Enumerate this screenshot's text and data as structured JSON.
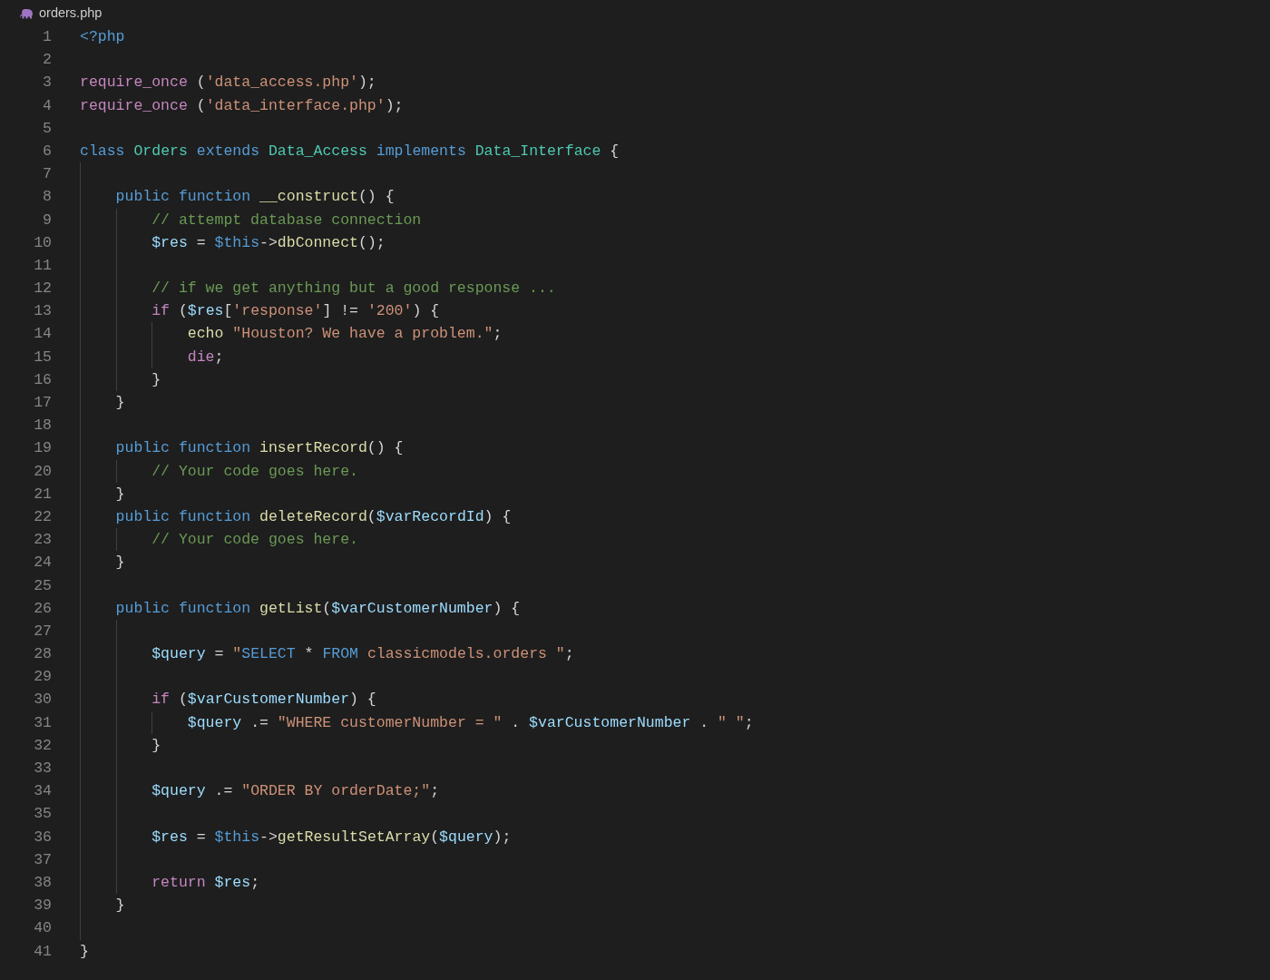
{
  "tab": {
    "label": "orders.php"
  },
  "lines": [
    {
      "number": "1",
      "tokens": [
        {
          "kind": "keyword",
          "text": "<?php"
        }
      ]
    },
    {
      "number": "2"
    },
    {
      "number": "3",
      "tokens": [
        {
          "kind": "control",
          "text": "require_once"
        },
        {
          "kind": "plain",
          "text": " ("
        },
        {
          "kind": "string",
          "text": "'data_access.php'"
        },
        {
          "kind": "plain",
          "text": ");"
        }
      ]
    },
    {
      "number": "4",
      "tokens": [
        {
          "kind": "control",
          "text": "require_once"
        },
        {
          "kind": "plain",
          "text": " ("
        },
        {
          "kind": "string",
          "text": "'data_interface.php'"
        },
        {
          "kind": "plain",
          "text": ");"
        }
      ]
    },
    {
      "number": "5"
    },
    {
      "number": "6",
      "tokens": [
        {
          "kind": "keyword",
          "text": "class "
        },
        {
          "kind": "type",
          "text": "Orders"
        },
        {
          "kind": "keyword",
          "text": " extends "
        },
        {
          "kind": "type",
          "text": "Data_Access"
        },
        {
          "kind": "keyword",
          "text": " implements "
        },
        {
          "kind": "type",
          "text": "Data_Interface"
        },
        {
          "kind": "plain",
          "text": " {"
        }
      ],
      "children": [
        {
          "number": "7"
        },
        {
          "number": "8",
          "tokens": [
            {
              "kind": "keyword",
              "text": "public function "
            },
            {
              "kind": "function",
              "text": "__construct"
            },
            {
              "kind": "plain",
              "text": "() {"
            }
          ],
          "children": [
            {
              "number": "9",
              "tokens": [
                {
                  "kind": "comment",
                  "text": "// attempt database connection"
                }
              ]
            },
            {
              "number": "10",
              "tokens": [
                {
                  "kind": "variable",
                  "text": "$res"
                },
                {
                  "kind": "plain",
                  "text": " = "
                },
                {
                  "kind": "keyword",
                  "text": "$this"
                },
                {
                  "kind": "plain",
                  "text": "->"
                },
                {
                  "kind": "function",
                  "text": "dbConnect"
                },
                {
                  "kind": "plain",
                  "text": "();"
                }
              ]
            },
            {
              "number": "11"
            },
            {
              "number": "12",
              "tokens": [
                {
                  "kind": "comment",
                  "text": "// if we get anything but a good response ..."
                }
              ]
            },
            {
              "number": "13",
              "tokens": [
                {
                  "kind": "control",
                  "text": "if"
                },
                {
                  "kind": "plain",
                  "text": " ("
                },
                {
                  "kind": "variable",
                  "text": "$res"
                },
                {
                  "kind": "plain",
                  "text": "["
                },
                {
                  "kind": "string",
                  "text": "'response'"
                },
                {
                  "kind": "plain",
                  "text": "] != "
                },
                {
                  "kind": "string",
                  "text": "'200'"
                },
                {
                  "kind": "plain",
                  "text": ") {"
                }
              ],
              "children": [
                {
                  "number": "14",
                  "tokens": [
                    {
                      "kind": "function",
                      "text": "echo"
                    },
                    {
                      "kind": "string",
                      "text": " \"Houston? We have a problem.\""
                    },
                    {
                      "kind": "plain",
                      "text": ";"
                    }
                  ]
                },
                {
                  "number": "15",
                  "tokens": [
                    {
                      "kind": "control",
                      "text": "die"
                    },
                    {
                      "kind": "plain",
                      "text": ";"
                    }
                  ]
                }
              ]
            },
            {
              "number": "16",
              "tokens": [
                {
                  "kind": "plain",
                  "text": "}"
                }
              ]
            }
          ]
        },
        {
          "number": "17",
          "tokens": [
            {
              "kind": "plain",
              "text": "}"
            }
          ]
        },
        {
          "number": "18"
        },
        {
          "number": "19",
          "tokens": [
            {
              "kind": "keyword",
              "text": "public function "
            },
            {
              "kind": "function",
              "text": "insertRecord"
            },
            {
              "kind": "plain",
              "text": "() {"
            }
          ],
          "children": [
            {
              "number": "20",
              "tokens": [
                {
                  "kind": "comment",
                  "text": "// Your code goes here."
                }
              ]
            }
          ]
        },
        {
          "number": "21",
          "tokens": [
            {
              "kind": "plain",
              "text": "}"
            }
          ]
        },
        {
          "number": "22",
          "tokens": [
            {
              "kind": "keyword",
              "text": "public function "
            },
            {
              "kind": "function",
              "text": "deleteRecord"
            },
            {
              "kind": "plain",
              "text": "("
            },
            {
              "kind": "variable",
              "text": "$varRecordId"
            },
            {
              "kind": "plain",
              "text": ") {"
            }
          ],
          "children": [
            {
              "number": "23",
              "tokens": [
                {
                  "kind": "comment",
                  "text": "// Your code goes here."
                }
              ]
            }
          ]
        },
        {
          "number": "24",
          "tokens": [
            {
              "kind": "plain",
              "text": "}"
            }
          ]
        },
        {
          "number": "25"
        },
        {
          "number": "26",
          "tokens": [
            {
              "kind": "keyword",
              "text": "public function "
            },
            {
              "kind": "function",
              "text": "getList"
            },
            {
              "kind": "plain",
              "text": "("
            },
            {
              "kind": "variable",
              "text": "$varCustomerNumber"
            },
            {
              "kind": "plain",
              "text": ") {"
            }
          ],
          "children": [
            {
              "number": "27"
            },
            {
              "number": "28",
              "tokens": [
                {
                  "kind": "variable",
                  "text": "$query"
                },
                {
                  "kind": "plain",
                  "text": " = "
                },
                {
                  "kind": "string",
                  "text": "\""
                },
                {
                  "kind": "keyword",
                  "text": "SELECT"
                },
                {
                  "kind": "plain",
                  "text": " * "
                },
                {
                  "kind": "keyword",
                  "text": "FROM"
                },
                {
                  "kind": "string",
                  "text": " classicmodels.orders \""
                },
                {
                  "kind": "plain",
                  "text": ";"
                }
              ]
            },
            {
              "number": "29"
            },
            {
              "number": "30",
              "tokens": [
                {
                  "kind": "control",
                  "text": "if"
                },
                {
                  "kind": "plain",
                  "text": " ("
                },
                {
                  "kind": "variable",
                  "text": "$varCustomerNumber"
                },
                {
                  "kind": "plain",
                  "text": ") {"
                }
              ],
              "children": [
                {
                  "number": "31",
                  "tokens": [
                    {
                      "kind": "variable",
                      "text": "$query"
                    },
                    {
                      "kind": "plain",
                      "text": " .= "
                    },
                    {
                      "kind": "string",
                      "text": "\"WHERE customerNumber = \""
                    },
                    {
                      "kind": "plain",
                      "text": " . "
                    },
                    {
                      "kind": "variable",
                      "text": "$varCustomerNumber"
                    },
                    {
                      "kind": "plain",
                      "text": " . "
                    },
                    {
                      "kind": "string",
                      "text": "\" \""
                    },
                    {
                      "kind": "plain",
                      "text": ";"
                    }
                  ]
                }
              ]
            },
            {
              "number": "32",
              "tokens": [
                {
                  "kind": "plain",
                  "text": "}"
                }
              ]
            },
            {
              "number": "33"
            },
            {
              "number": "34",
              "tokens": [
                {
                  "kind": "variable",
                  "text": "$query"
                },
                {
                  "kind": "plain",
                  "text": " .= "
                },
                {
                  "kind": "string",
                  "text": "\"ORDER BY orderDate;\""
                },
                {
                  "kind": "plain",
                  "text": ";"
                }
              ]
            },
            {
              "number": "35"
            },
            {
              "number": "36",
              "tokens": [
                {
                  "kind": "variable",
                  "text": "$res"
                },
                {
                  "kind": "plain",
                  "text": " = "
                },
                {
                  "kind": "keyword",
                  "text": "$this"
                },
                {
                  "kind": "plain",
                  "text": "->"
                },
                {
                  "kind": "function",
                  "text": "getResultSetArray"
                },
                {
                  "kind": "plain",
                  "text": "("
                },
                {
                  "kind": "variable",
                  "text": "$query"
                },
                {
                  "kind": "plain",
                  "text": ");"
                }
              ]
            },
            {
              "number": "37"
            },
            {
              "number": "38",
              "tokens": [
                {
                  "kind": "control",
                  "text": "return "
                },
                {
                  "kind": "variable",
                  "text": "$res"
                },
                {
                  "kind": "plain",
                  "text": ";"
                }
              ]
            }
          ]
        },
        {
          "number": "39",
          "tokens": [
            {
              "kind": "plain",
              "text": "}"
            }
          ]
        },
        {
          "number": "40"
        }
      ]
    },
    {
      "number": "41",
      "tokens": [
        {
          "kind": "plain",
          "text": "}"
        }
      ]
    }
  ]
}
